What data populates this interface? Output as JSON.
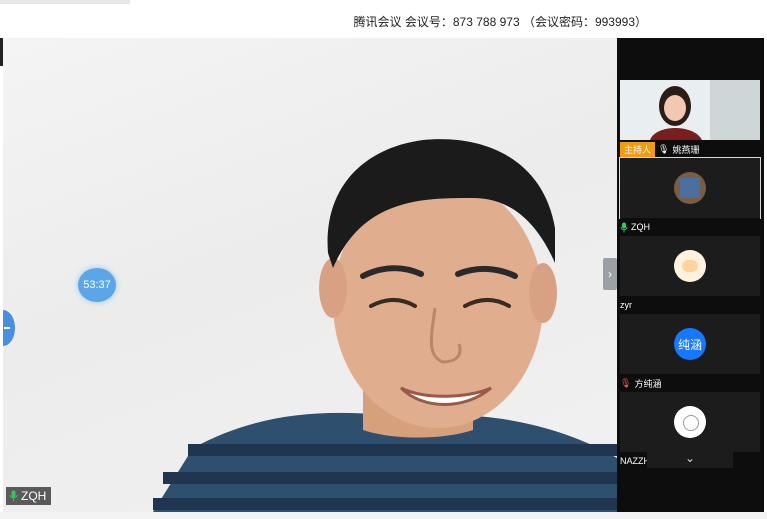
{
  "meeting": {
    "info": "腾讯会议 会议号：873 788 973 （会议密码：993993）"
  },
  "main": {
    "timer": "53:37",
    "speaker": "ZQH"
  },
  "participants": [
    {
      "name": "姚燕珊",
      "role": "主持人",
      "avatar": "photo-icon"
    },
    {
      "name": "ZQH",
      "avatar": "bookshelf-avatar-icon"
    },
    {
      "name": "zyr",
      "avatar": "cartoon-avatar-icon"
    },
    {
      "name": "方纯涵",
      "avatar_text": "纯涵"
    },
    {
      "name": "NAZZH",
      "avatar": "sketch-avatar-icon"
    }
  ],
  "colors": {
    "panel_bg": "#0d0d0d",
    "host_tag": "#f39c12",
    "avatar_blue": "#1677ff",
    "timer_bg": "#5aa6e8"
  }
}
